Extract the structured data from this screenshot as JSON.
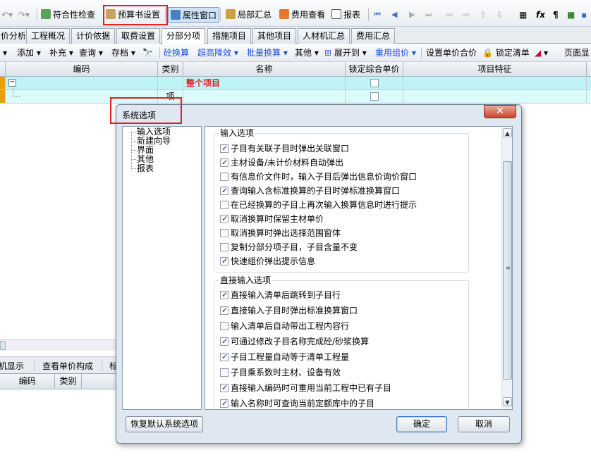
{
  "toolbar": {
    "check_label": "符合性检查",
    "budget_settings_label": "预算书设置",
    "property_window_label": "属性窗口",
    "partial_summary_label": "局部汇总",
    "fee_view_label": "费用查看",
    "report_label": "报表"
  },
  "tabs": [
    {
      "label": "价分析"
    },
    {
      "label": "工程概况"
    },
    {
      "label": "计价依据"
    },
    {
      "label": "取费设置"
    },
    {
      "label": "分部分项"
    },
    {
      "label": "措施项目"
    },
    {
      "label": "其他项目"
    },
    {
      "label": "人材机汇总"
    },
    {
      "label": "费用汇总"
    }
  ],
  "toolbar2": {
    "add": "添加",
    "supplement": "补充",
    "query": "查询",
    "save": "存档",
    "concrete_convert": "砼换算",
    "super_high_reduction": "超高降效",
    "batch_convert": "批量换算",
    "other": "其他",
    "expand_to": "展开到",
    "reuse_price": "重用组价",
    "set_unit_price": "设置单价合价",
    "lock_list": "锁定清单",
    "page_display": "页面显"
  },
  "grid": {
    "columns": [
      "编码",
      "类别",
      "名称",
      "锁定综合单价",
      "项目特征"
    ],
    "rows": [
      {
        "code": "",
        "category": "",
        "name": "整个项目",
        "locked": false
      },
      {
        "code": "",
        "category": "项",
        "name": "",
        "locked": false
      }
    ]
  },
  "bottom": {
    "tabs": [
      "机显示",
      "查看单价构成",
      "标"
    ],
    "columns": [
      "编码",
      "类别"
    ]
  },
  "dialog": {
    "title": "系统选项",
    "close_glyph": "✕",
    "tree": [
      "输入选项",
      "新建向导",
      "界面",
      "其他",
      "报表"
    ],
    "group1": {
      "title": "输入选项",
      "options": [
        {
          "label": "子目有关联子目时弹出关联窗口",
          "checked": true
        },
        {
          "label": "主材设备/未计价材料自动弹出",
          "checked": true
        },
        {
          "label": "有信息价文件时，输入子目后弹出信息价询价窗口",
          "checked": false
        },
        {
          "label": "查询输入含标准换算的子目时弹标准换算窗口",
          "checked": true
        },
        {
          "label": "在已经换算的子目上再次输入换算信息时进行提示",
          "checked": false
        },
        {
          "label": "取消换算时保留主材单价",
          "checked": true
        },
        {
          "label": "取消换算时弹出选择范围窗体",
          "checked": false
        },
        {
          "label": "复制分部分项子目，子目含量不变",
          "checked": false
        },
        {
          "label": "快速组价弹出提示信息",
          "checked": true
        }
      ]
    },
    "group2": {
      "title": "直接输入选项",
      "options": [
        {
          "label": "直接输入清单后跳转到子目行",
          "checked": true
        },
        {
          "label": "直接输入子目时弹出标准换算窗口",
          "checked": true
        },
        {
          "label": "输入清单后自动带出工程内容行",
          "checked": false
        },
        {
          "label": "可通过修改子目名称完成砼/砂浆换算",
          "checked": true
        },
        {
          "label": "子目工程量自动等于清单工程量",
          "checked": true
        },
        {
          "label": "子目乘系数时主材、设备有效",
          "checked": false
        },
        {
          "label": "直接输入编码时可重用当前工程中已有子目",
          "checked": true
        },
        {
          "label": "输入名称时可查询当前定额库中的子目",
          "checked": true
        }
      ]
    },
    "restore_label": "恢复默认系统选项",
    "ok_label": "确定",
    "cancel_label": "取消"
  }
}
